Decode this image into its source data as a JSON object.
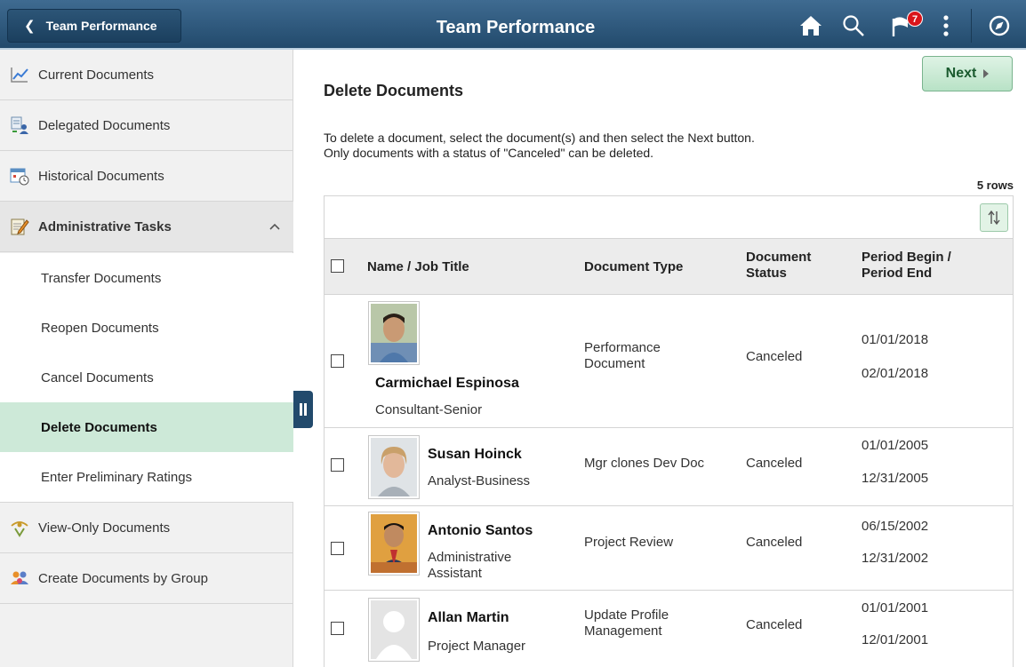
{
  "header": {
    "back_label": "Team Performance",
    "title": "Team Performance",
    "notification_count": "7",
    "icons": [
      "home-icon",
      "search-icon",
      "notifications-flag-icon",
      "actions-menu-icon",
      "navbar-compass-icon"
    ]
  },
  "sidebar": {
    "items": [
      {
        "label": "Current Documents",
        "icon": "chart-line-icon"
      },
      {
        "label": "Delegated Documents",
        "icon": "delegate-icon"
      },
      {
        "label": "Historical Documents",
        "icon": "calendar-clock-icon"
      },
      {
        "label": "Administrative Tasks",
        "icon": "notepad-pencil-icon"
      },
      {
        "label": "View-Only Documents",
        "icon": "eye-hand-icon"
      },
      {
        "label": "Create Documents by Group",
        "icon": "group-people-icon"
      }
    ],
    "sub_items": [
      {
        "label": "Transfer Documents"
      },
      {
        "label": "Reopen Documents"
      },
      {
        "label": "Cancel  Documents"
      },
      {
        "label": "Delete Documents"
      },
      {
        "label": "Enter Preliminary Ratings"
      }
    ]
  },
  "main": {
    "title": "Delete Documents",
    "next_label": "Next",
    "instruction_line1": "To delete a document, select the document(s) and then select the Next button.",
    "instruction_line2": "Only documents with a status of \"Canceled\" can be deleted.",
    "rows_count": "5 rows",
    "columns": {
      "name": "Name / Job Title",
      "doc_type": "Document Type",
      "status_1": "Document",
      "status_2": "Status",
      "period_1": "Period Begin /",
      "period_2": "Period End"
    },
    "rows": [
      {
        "name": "Carmichael Espinosa",
        "title": "Consultant-Senior",
        "doc_type_1": "Performance",
        "doc_type_2": "Document",
        "status": "Canceled",
        "begin": "01/01/2018",
        "end": "02/01/2018"
      },
      {
        "name": "Susan Hoinck",
        "title": "Analyst-Business",
        "doc_type_1": "Mgr clones Dev Doc",
        "doc_type_2": "",
        "status": "Canceled",
        "begin": "01/01/2005",
        "end": "12/31/2005"
      },
      {
        "name": "Antonio Santos",
        "title": "Administrative",
        "title_2": "Assistant",
        "doc_type_1": "Project Review",
        "doc_type_2": "",
        "status": "Canceled",
        "begin": "06/15/2002",
        "end": "12/31/2002"
      },
      {
        "name": "Allan Martin",
        "title": "Project Manager",
        "doc_type_1": "Update Profile",
        "doc_type_2": "Management",
        "status": "Canceled",
        "begin": "01/01/2001",
        "end": "12/01/2001"
      }
    ]
  },
  "colors": {
    "header_top": "#3f6b91",
    "header_bottom": "#224a6c",
    "active_sub_bg": "#cde9d8",
    "next_button_bg": "#b8e2c6",
    "badge_red": "#d9151a"
  }
}
